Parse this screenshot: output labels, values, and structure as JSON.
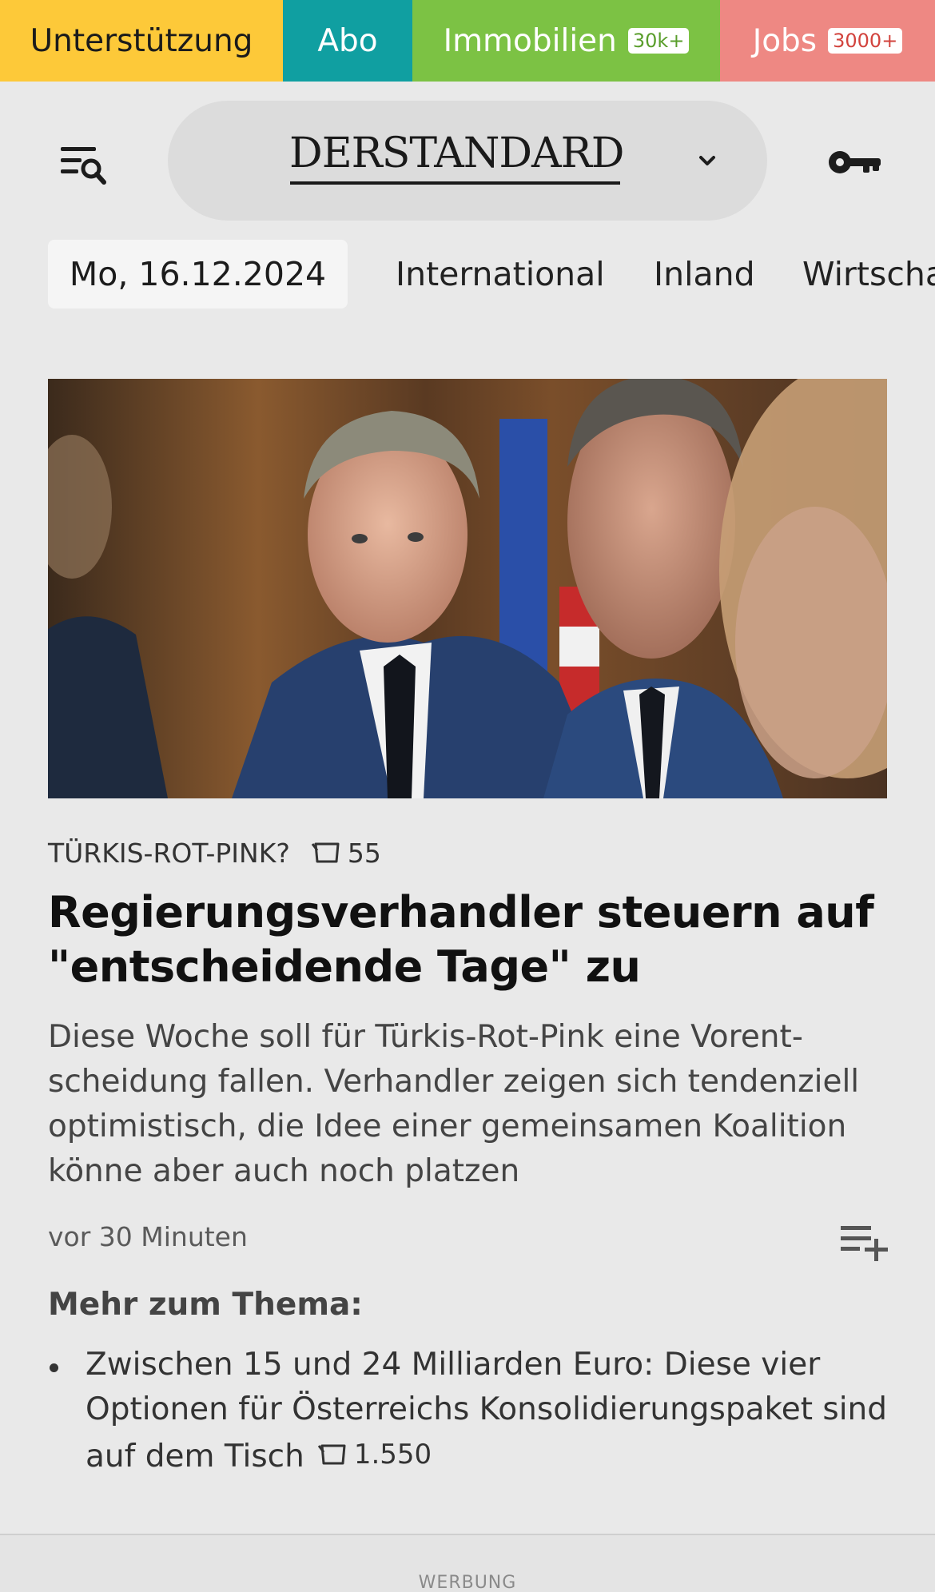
{
  "topbar": {
    "support_label": "Unterstützung",
    "abo_label": "Abo",
    "immobilien_label": "Immobilien",
    "immobilien_badge": "30k+",
    "jobs_label": "Jobs",
    "jobs_badge": "3000+",
    "colors": {
      "support": "#fdc939",
      "abo": "#109fa1",
      "immobilien": "#7cc244",
      "jobs": "#ee8883"
    }
  },
  "header": {
    "logo_text": "DERSTANDARD",
    "menu_icon": "menu-search-icon",
    "chevron_icon": "chevron-down-icon",
    "key_icon": "key-icon"
  },
  "nav": {
    "date": "Mo, 16.12.2024",
    "items": [
      "International",
      "Inland",
      "Wirtscha"
    ]
  },
  "article": {
    "image_alt": "Regierungsverhandler bei Pressekonferenz",
    "kicker": "TÜRKIS-ROT-PINK?",
    "comment_count": "55",
    "headline": "Regierungsverhandler steuern auf \"entscheidende Tage\" zu",
    "teaser": "Diese Woche soll für Türkis-Rot-Pink eine Vorent­scheidung fallen. Verhandler zeigen sich tendenziell optimistisch, die Idee einer gemeinsamen Koalition könne aber auch noch platzen",
    "time": "vor 30 Minuten",
    "playlist_icon": "playlist-add-icon"
  },
  "more": {
    "title": "Mehr zum Thema:",
    "items": [
      {
        "text": "Zwischen 15 und 24 Milliarden Euro: Diese vier Optionen für Österreichs Konsolidierungspaket sind auf dem Tisch",
        "comments": "1.550"
      }
    ]
  },
  "ad": {
    "label": "WERBUNG"
  }
}
